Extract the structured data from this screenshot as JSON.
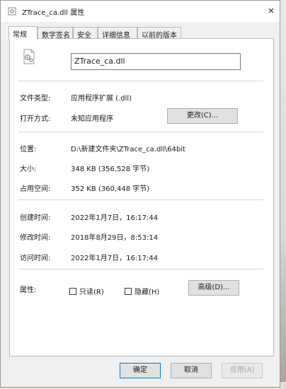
{
  "window": {
    "title": "ZTrace_ca.dll 属性",
    "close_glyph": "✕"
  },
  "tabs": [
    {
      "label": "常规",
      "active": true
    },
    {
      "label": "数字签名",
      "active": false
    },
    {
      "label": "安全",
      "active": false
    },
    {
      "label": "详细信息",
      "active": false
    },
    {
      "label": "以前的版本",
      "active": false
    }
  ],
  "general": {
    "file_name": "ZTrace_ca.dll",
    "file_type_label": "文件类型:",
    "file_type_value": "应用程序扩展 (.dll)",
    "opens_with_label": "打开方式:",
    "opens_with_value": "未知应用程序",
    "change_button": "更改(C)...",
    "location_label": "位置:",
    "location_value": "D:\\新建文件夹\\ZTrace_ca.dll\\64bit",
    "size_label": "大小:",
    "size_value": "348 KB (356,528 字节)",
    "size_on_disk_label": "占用空间:",
    "size_on_disk_value": "352 KB (360,448 字节)",
    "created_label": "创建时间:",
    "created_value": "2022年1月7日，16:17:44",
    "modified_label": "修改时间:",
    "modified_value": "2018年8月29日，8:53:14",
    "accessed_label": "访问时间:",
    "accessed_value": "2022年1月7日，16:17:44",
    "attributes_label": "属性:",
    "readonly_label": "只读(R)",
    "hidden_label": "隐藏(H)",
    "advanced_button": "高级(D)..."
  },
  "footer": {
    "ok": "确定",
    "cancel": "取消",
    "apply": "应用(A)"
  },
  "colors": {
    "accent": "#0078d7",
    "panel_bg": "#ffffff",
    "window_bg": "#f0f0f0"
  }
}
